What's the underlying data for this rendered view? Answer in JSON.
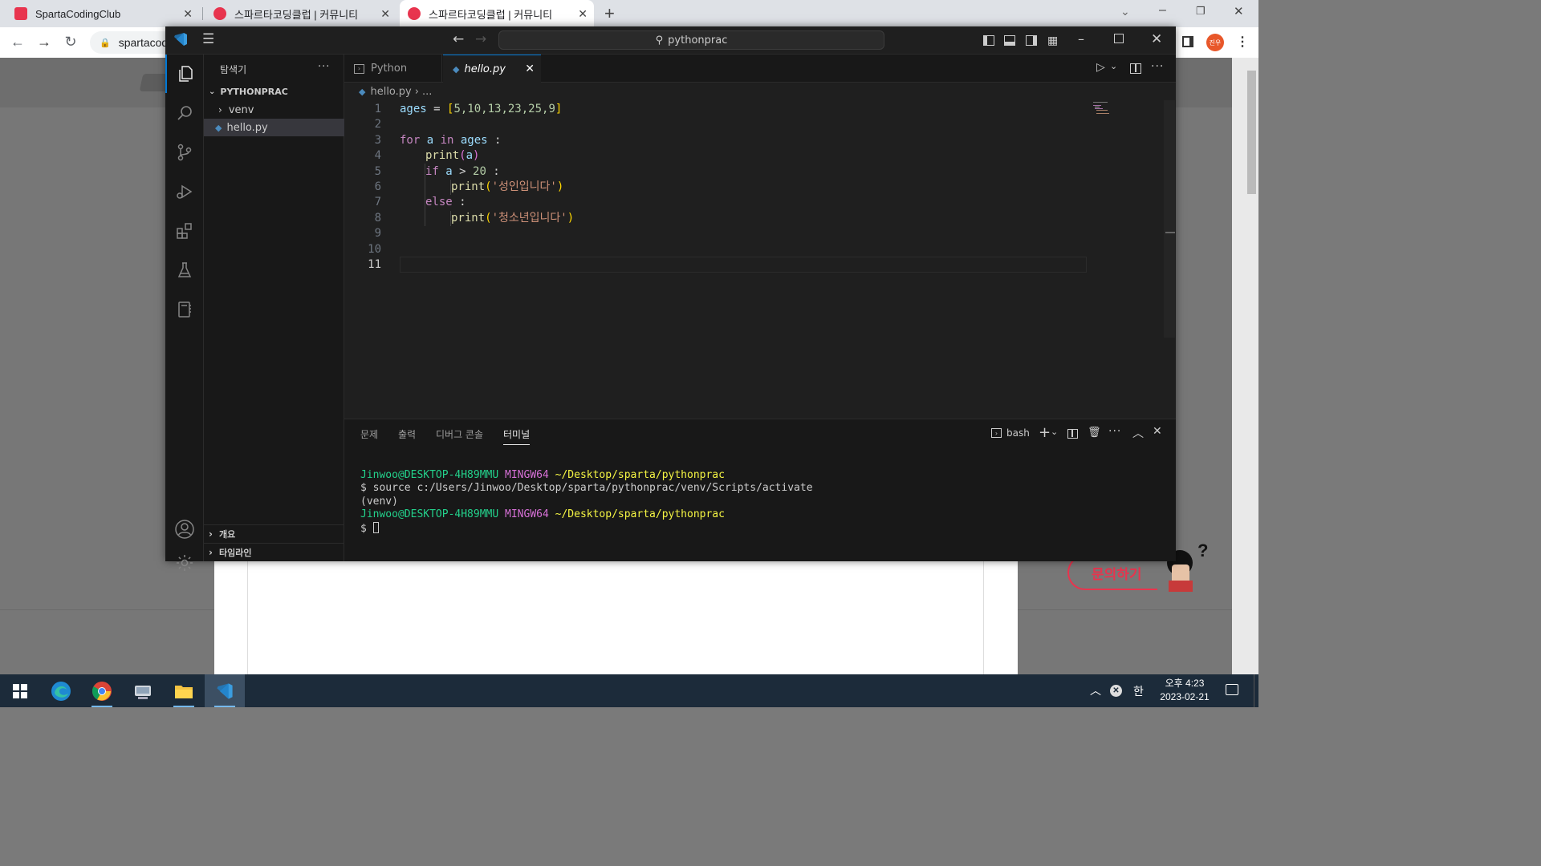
{
  "browser": {
    "tabs": [
      {
        "title": "SpartaCodingClub",
        "favicon_color": "#e8344e"
      },
      {
        "title": "스파르타코딩클럽 | 커뮤니티",
        "favicon_color": "#e8344e"
      },
      {
        "title": "스파르타코딩클럽 | 커뮤니티",
        "favicon_color": "#e8344e"
      }
    ],
    "new_tab_label": "+",
    "url_partial": "spartacod",
    "profile_initials": "진우",
    "window_controls": [
      "chevron-down-icon",
      "minimize-icon",
      "restore-icon",
      "close-icon"
    ]
  },
  "page": {
    "inquiry_label": "문의하기"
  },
  "vscode": {
    "search_text": "pythonprac",
    "sidebar_title": "탐색기",
    "explorer_more": "···",
    "project": "PYTHONPRAC",
    "tree": [
      {
        "label": "venv",
        "type": "folder"
      },
      {
        "label": "hello.py",
        "type": "file",
        "selected": true
      }
    ],
    "outline": "개요",
    "timeline": "타임라인",
    "tabs": [
      {
        "label": "Python",
        "active": false
      },
      {
        "label": "hello.py",
        "active": true
      }
    ],
    "breadcrumb": {
      "file": "hello.py",
      "rest": "..."
    },
    "line_numbers": [
      "1",
      "2",
      "3",
      "4",
      "5",
      "6",
      "7",
      "8",
      "9",
      "10",
      "11"
    ],
    "code": {
      "l1": {
        "var": "ages",
        "eq": " = ",
        "lb": "[",
        "vals": "5,10,13,23,25,9",
        "rb": "]"
      },
      "l3": {
        "kw1": "for",
        "a": " a ",
        "kw2": "in",
        "ages": " ages",
        "colon": " :"
      },
      "l4": {
        "fn": "print",
        "lp": "(",
        "a": "a",
        "rp": ")"
      },
      "l5": {
        "kw": "if",
        "a": " a ",
        "op": "> ",
        "num": "20",
        "colon": " :"
      },
      "l6": {
        "fn": "print",
        "lp": "(",
        "str": "'성인입니다'",
        "rp": ")"
      },
      "l7": {
        "kw": "else",
        "colon": " :"
      },
      "l8": {
        "fn": "print",
        "lp": "(",
        "str": "'청소년입니다'",
        "rp": ")"
      }
    },
    "panel_tabs": [
      "문제",
      "출력",
      "디버그 콘솔",
      "터미널"
    ],
    "panel_active": "터미널",
    "shell": "bash",
    "terminal": {
      "user": "Jinwoo@DESKTOP-4H89MMU",
      "env": "MINGW64",
      "path": "~/Desktop/sparta/pythonprac",
      "cmd": "$ source c:/Users/Jinwoo/Desktop/sparta/pythonprac/venv/Scripts/activate",
      "venv": "(venv)",
      "prompt": "$ "
    }
  },
  "taskbar": {
    "time": "오후 4:23",
    "date": "2023-02-21",
    "ime": "한"
  }
}
